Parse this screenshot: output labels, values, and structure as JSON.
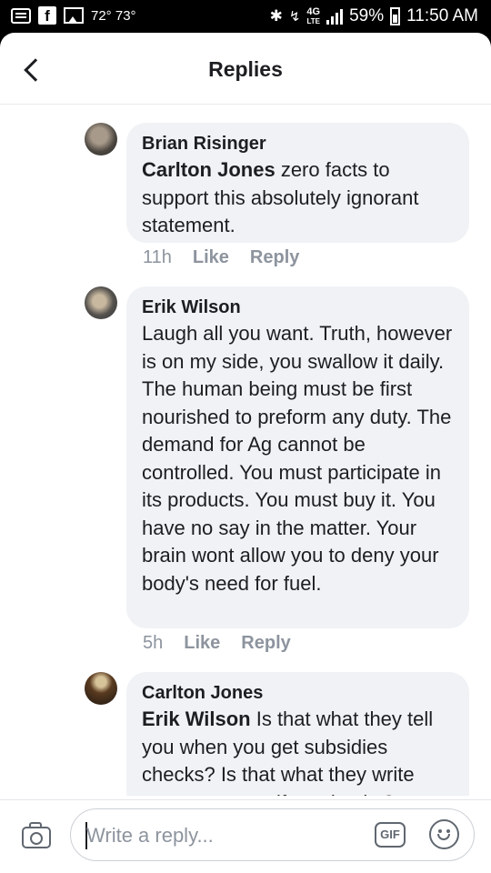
{
  "status_bar": {
    "temperature": "72° 73°",
    "network": "4G",
    "network_sub": "LTE",
    "battery": "59%",
    "time": "11:50 AM"
  },
  "header": {
    "title": "Replies"
  },
  "comments": [
    {
      "author": "Brian Risinger",
      "mention": "Carlton Jones",
      "text": " zero facts to support this absolutely ignorant statement.",
      "time": "11h",
      "like": "Like",
      "reply": "Reply"
    },
    {
      "author": "Erik Wilson",
      "mention": "",
      "text": "Laugh all you want. Truth, however is on my side, you swallow it daily. The human being must be first nourished to preform any duty. The demand for Ag cannot be controlled. You must participate in its products. You must buy it. You have no say in the matter. Your brain wont allow you to deny your body's need for fuel.",
      "time": "5h",
      "like": "Like",
      "reply": "Reply"
    },
    {
      "author": "Carlton Jones",
      "mention": "Erik Wilson",
      "text": " Is that what they tell you when you get subsidies checks?  Is that what they write across your welfare checks?",
      "time": "",
      "like": "",
      "reply": ""
    }
  ],
  "composer": {
    "placeholder": "Write a reply...",
    "gif_label": "GIF"
  },
  "icons": {
    "back": "chevron-left-icon",
    "camera": "camera-icon",
    "gif": "gif-icon",
    "emoji": "emoji-icon"
  },
  "colors": {
    "bubble": "#f0f2f5",
    "text": "#1c1e21",
    "secondary": "#8d949e"
  }
}
